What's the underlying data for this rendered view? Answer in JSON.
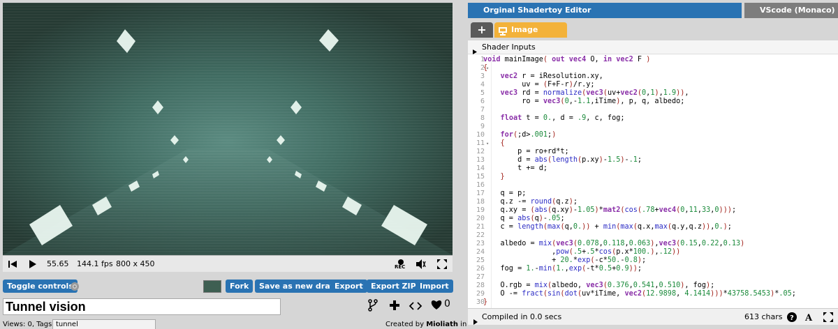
{
  "editor_tabs": {
    "original": "Orginal Shadertoy Editor",
    "monaco": "VScode (Monaco) Editor",
    "active_color": "#2a73b3",
    "inactive_color": "#7d7d7d"
  },
  "player": {
    "time": "55.65",
    "fps": "144.1 fps",
    "resolution": "800 x 450",
    "rec_label": "REC"
  },
  "buttons": {
    "toggle_controls": "Toggle controls",
    "fork": "Fork",
    "save_draft": "Save as new draft",
    "export": "Export",
    "export_zip": "Export ZIP",
    "import": "Import"
  },
  "shader": {
    "title": "Tunnel vision",
    "views_label": "Views: 0, Tags:",
    "tags_value": "tunnel",
    "created_by_prefix": "Created by",
    "author": "Mioliath",
    "created_by_suffix": "in",
    "likes": "0"
  },
  "code_tabs": {
    "add_label": "+",
    "image_label": "Image",
    "image_color": "#f3b23a"
  },
  "shader_inputs_label": "Shader Inputs",
  "code_lines": [
    "void mainImage( out vec4 O, in vec2 F )",
    "{",
    "    vec2 r = iResolution.xy,",
    "         uv = (F+F-r)/r.y;",
    "    vec3 rd = normalize(vec3(uv+vec2(0,1),1.9)),",
    "         ro = vec3(0,-1.1,iTime), p, q, albedo;",
    "",
    "    float t = 0., d = .9, c, fog;",
    "",
    "    for(;d>.001;)",
    "    {",
    "        p = ro+rd*t;",
    "        d = abs(length(p.xy)-1.5)-.1;",
    "        t += d;",
    "    }",
    "",
    "    q = p;",
    "    q.z -= round(q.z);",
    "    q.xy = (abs(q.xy)-1.05)*mat2(cos(.78+vec4(0,11,33,0)));",
    "    q = abs(q)-.05;",
    "    c = length(max(q,0.)) + min(max(q.x,max(q.y,q.z)),0.);",
    "",
    "    albedo = mix(vec3(0.078,0.118,0.063),vec3(0.15,0.22,0.13)",
    "                ,pow(.5+.5*cos(p.x*100.),.12))",
    "                + 20.*exp(-c*50.-0.8);",
    "    fog = 1.-min(1.,exp(-t*0.5+0.9));",
    "",
    "    O.rgb = mix(albedo, vec3(0.376,0.541,0.510), fog);",
    "    O -= fract(sin(dot(uv*iTime, vec2(12.9898, 4.1414)))*43758.5453)*.05;",
    "}"
  ],
  "status": {
    "compiled": "Compiled in 0.0 secs",
    "chars": "613 chars"
  }
}
